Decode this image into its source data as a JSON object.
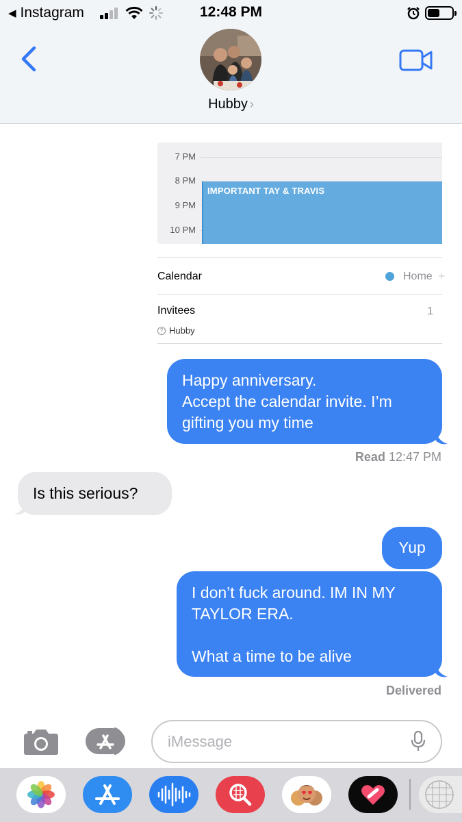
{
  "status_bar": {
    "back_app": "Instagram",
    "time": "12:48 PM"
  },
  "header": {
    "contact_name": "Hubby",
    "chevron": "›"
  },
  "icons": {
    "back": "chevron-left-icon",
    "video": "video-camera-icon",
    "camera": "camera-icon",
    "apps": "app-store-icon",
    "mic": "microphone-icon"
  },
  "calendar_preview": {
    "hours": [
      "7 PM",
      "8 PM",
      "9 PM",
      "10 PM"
    ],
    "event_title": "IMPORTANT TAY & TRAVIS",
    "calendar_label": "Calendar",
    "calendar_value": "Home",
    "calendar_value_more": "÷",
    "invitees_label": "Invitees",
    "invitees_count": "1",
    "invitee_name": "Hubby",
    "calendar_color": "#4fa3d9"
  },
  "messages": [
    {
      "from": "me",
      "lines": [
        "Happy anniversary.",
        "Accept the calendar invite. I’m",
        "gifting you my time"
      ]
    },
    {
      "from": "them",
      "lines": [
        "Is this serious?"
      ]
    },
    {
      "from": "me",
      "lines": [
        "Yup"
      ]
    },
    {
      "from": "me",
      "lines": [
        "I don’t fuck around. IM IN MY",
        "TAYLOR ERA.",
        "",
        "What a time to be alive"
      ]
    }
  ],
  "receipts": {
    "read_label": "Read",
    "read_time": "12:47 PM",
    "delivered": "Delivered"
  },
  "composer": {
    "placeholder": "iMessage"
  },
  "app_drawer": [
    "photos-icon",
    "app-store-icon",
    "audio-message-icon",
    "image-search-icon",
    "memoji-icon",
    "digital-touch-icon",
    "more-apps-icon"
  ],
  "colors": {
    "accent": "#3b82f2",
    "incoming_bubble": "#e9e9eb"
  }
}
